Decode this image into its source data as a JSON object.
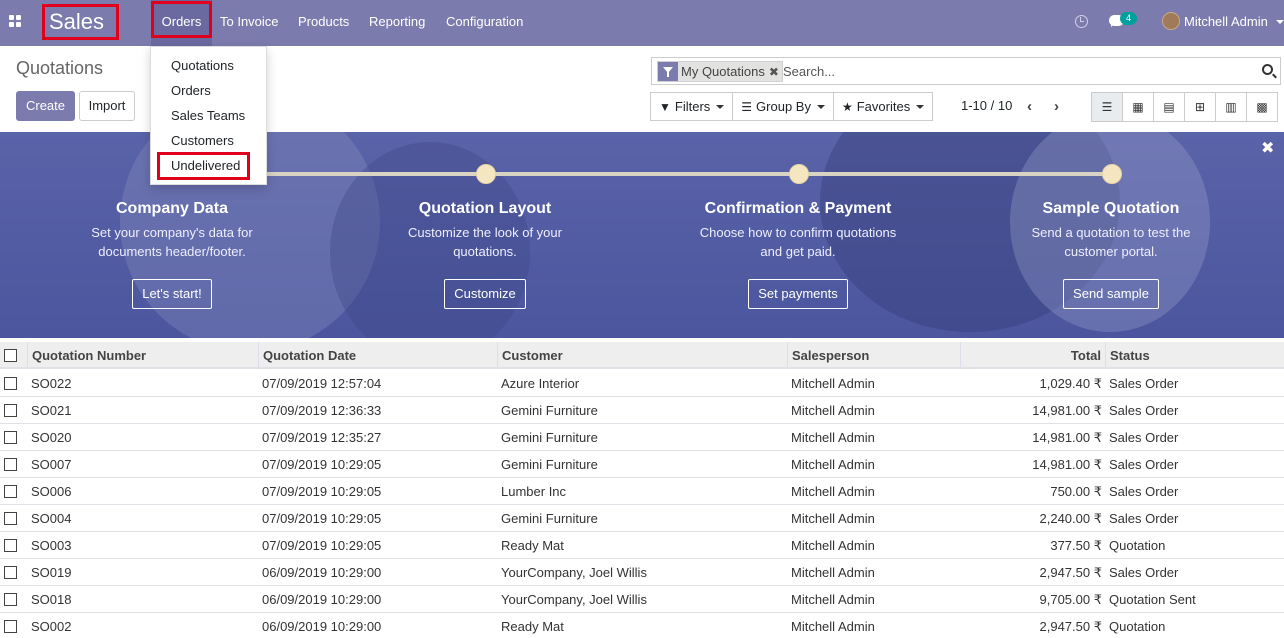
{
  "navbar": {
    "brand": "Sales",
    "menu": [
      "Orders",
      "To Invoice",
      "Products",
      "Reporting",
      "Configuration"
    ],
    "messages_badge": "4",
    "user_name": "Mitchell Admin"
  },
  "orders_menu": {
    "items": [
      "Quotations",
      "Orders",
      "Sales Teams",
      "Customers",
      "Undelivered"
    ]
  },
  "control_panel": {
    "title": "Quotations",
    "create_label": "Create",
    "import_label": "Import",
    "facet_label": "My Quotations",
    "search_placeholder": "Search...",
    "filters_label": "Filters",
    "groupby_label": "Group By",
    "favorites_label": "Favorites",
    "pager": "1-10 / 10"
  },
  "banner": {
    "steps": [
      {
        "title": "Company Data",
        "desc1": "Set your company's data for",
        "desc2": "documents header/footer.",
        "button": "Let's start!"
      },
      {
        "title": "Quotation Layout",
        "desc1": "Customize the look of your",
        "desc2": "quotations.",
        "button": "Customize"
      },
      {
        "title": "Confirmation & Payment",
        "desc1": "Choose how to confirm quotations",
        "desc2": "and get paid.",
        "button": "Set payments"
      },
      {
        "title": "Sample Quotation",
        "desc1": "Send a quotation to test the",
        "desc2": "customer portal.",
        "button": "Send sample"
      }
    ]
  },
  "table": {
    "headers": [
      "Quotation Number",
      "Quotation Date",
      "Customer",
      "Salesperson",
      "Total",
      "Status"
    ],
    "rows": [
      [
        "SO022",
        "07/09/2019 12:57:04",
        "Azure Interior",
        "Mitchell Admin",
        "1,029.40 ₹",
        "Sales Order"
      ],
      [
        "SO021",
        "07/09/2019 12:36:33",
        "Gemini Furniture",
        "Mitchell Admin",
        "14,981.00 ₹",
        "Sales Order"
      ],
      [
        "SO020",
        "07/09/2019 12:35:27",
        "Gemini Furniture",
        "Mitchell Admin",
        "14,981.00 ₹",
        "Sales Order"
      ],
      [
        "SO007",
        "07/09/2019 10:29:05",
        "Gemini Furniture",
        "Mitchell Admin",
        "14,981.00 ₹",
        "Sales Order"
      ],
      [
        "SO006",
        "07/09/2019 10:29:05",
        "Lumber Inc",
        "Mitchell Admin",
        "750.00 ₹",
        "Sales Order"
      ],
      [
        "SO004",
        "07/09/2019 10:29:05",
        "Gemini Furniture",
        "Mitchell Admin",
        "2,240.00 ₹",
        "Sales Order"
      ],
      [
        "SO003",
        "07/09/2019 10:29:05",
        "Ready Mat",
        "Mitchell Admin",
        "377.50 ₹",
        "Quotation"
      ],
      [
        "SO019",
        "06/09/2019 10:29:00",
        "YourCompany, Joel Willis",
        "Mitchell Admin",
        "2,947.50 ₹",
        "Sales Order"
      ],
      [
        "SO018",
        "06/09/2019 10:29:00",
        "YourCompany, Joel Willis",
        "Mitchell Admin",
        "9,705.00 ₹",
        "Quotation Sent"
      ],
      [
        "SO002",
        "06/09/2019 10:29:00",
        "Ready Mat",
        "Mitchell Admin",
        "2,947.50 ₹",
        "Quotation"
      ]
    ]
  },
  "colors": {
    "navbar": "#7c7bad",
    "highlight": "#e0001b",
    "banner": "#4b569e"
  }
}
